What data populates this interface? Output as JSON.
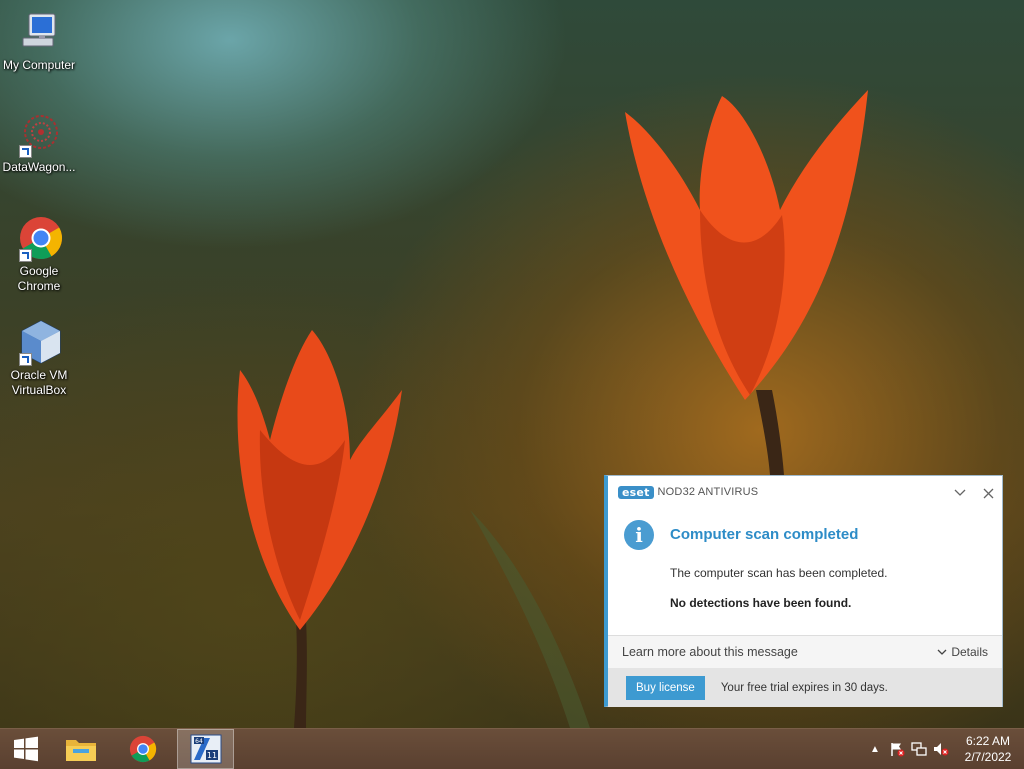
{
  "desktop": {
    "icons": [
      {
        "label": "My Computer"
      },
      {
        "label": "DataWagon..."
      },
      {
        "label_line1": "Google",
        "label_line2": "Chrome"
      },
      {
        "label_line1": "Oracle VM",
        "label_line2": "VirtualBox"
      }
    ]
  },
  "notification": {
    "brand_logo": "eset",
    "product": "NOD32 ANTIVIRUS",
    "minimize_icon": "chevron-down-icon",
    "close_icon": "close-icon",
    "title": "Computer scan completed",
    "message": "The computer scan has been completed.",
    "result": "No detections have been found.",
    "learn_more": "Learn more about this message",
    "details": "Details",
    "buy_label": "Buy license",
    "trial_text": "Your free trial expires in 30 days.",
    "accent_color": "#3d9ad1"
  },
  "taskbar": {
    "pinned": [
      "windows-start",
      "file-explorer",
      "google-chrome",
      "cpu-z-64"
    ],
    "tray": {
      "show_hidden_icon": "▲",
      "time": "6:22 AM",
      "date": "2/7/2022"
    }
  }
}
